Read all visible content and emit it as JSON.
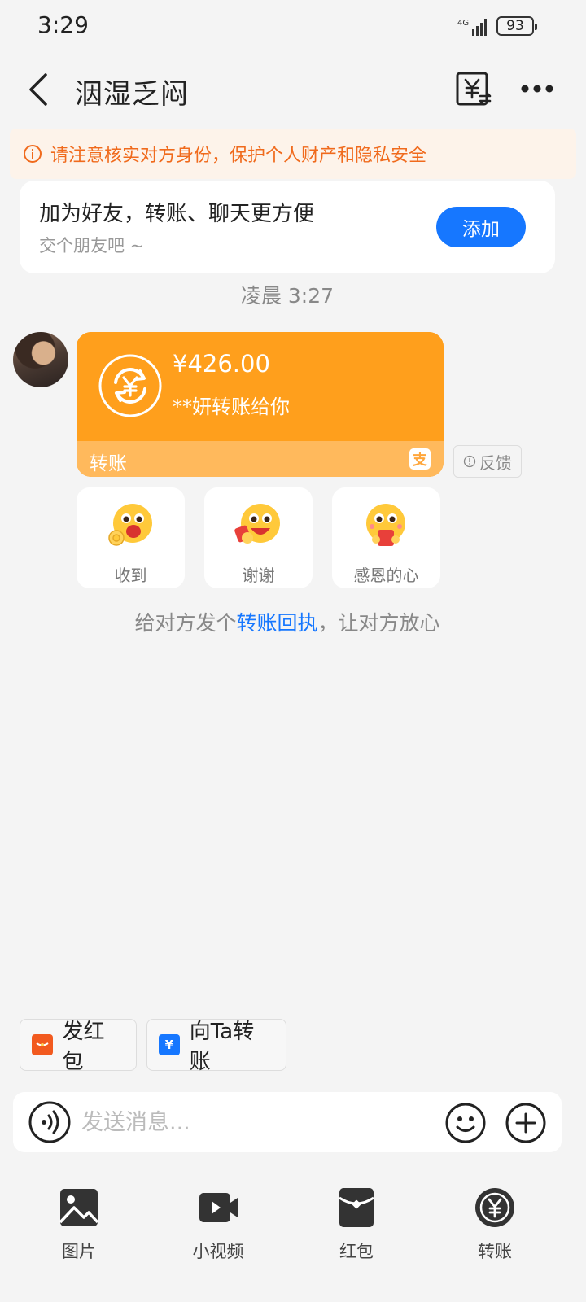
{
  "status_bar": {
    "time": "3:29",
    "network": "4G",
    "battery": "93"
  },
  "header": {
    "title": "洇湿乏闷"
  },
  "warning": {
    "text": "请注意核实对方身份，保护个人财产和隐私安全"
  },
  "friend_card": {
    "title": "加为好友，转账、聊天更方便",
    "subtitle": "交个朋友吧 ~",
    "add_label": "添加"
  },
  "timestamp": "凌晨 3:27",
  "transfer_message": {
    "amount": "¥426.00",
    "description": "**妍转账给你",
    "label": "转账"
  },
  "feedback_label": "反馈",
  "quick_replies": [
    {
      "label": "收到"
    },
    {
      "label": "谢谢"
    },
    {
      "label": "感恩的心"
    }
  ],
  "receipt_tip": {
    "prefix": "给对方发个",
    "link": "转账回执",
    "suffix": "，让对方放心"
  },
  "shortcuts": {
    "red_packet": "发红包",
    "transfer_to": "向Ta转账"
  },
  "input": {
    "placeholder": "发送消息..."
  },
  "panel": {
    "photo": "图片",
    "video": "小视频",
    "red_packet": "红包",
    "transfer": "转账"
  },
  "colors": {
    "accent_blue": "#1677ff",
    "transfer_orange": "#ff9f1c",
    "warning_orange": "#f06a1c"
  }
}
